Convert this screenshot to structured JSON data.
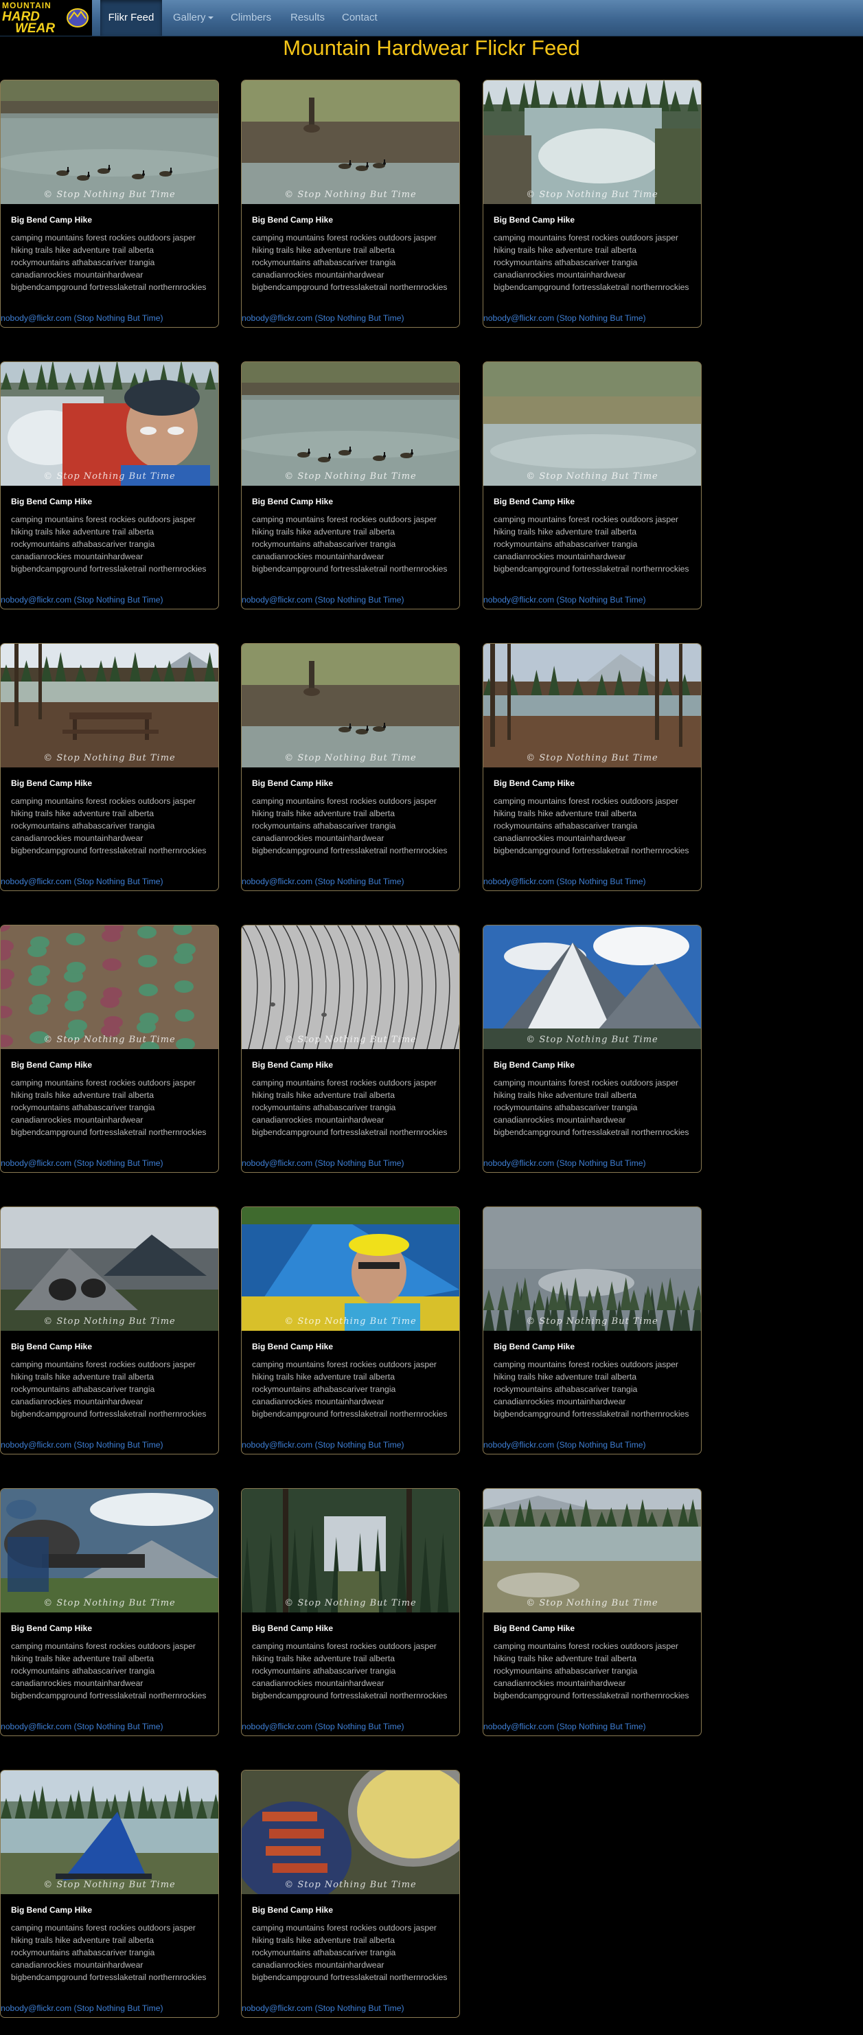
{
  "brand": {
    "line1": "MOUNTAIN",
    "line2": "HARD",
    "line3": "WEAR"
  },
  "nav": {
    "items": [
      {
        "label": "Flikr Feed",
        "active": true
      },
      {
        "label": "Gallery",
        "dropdown": true
      },
      {
        "label": "Climbers"
      },
      {
        "label": "Results"
      },
      {
        "label": "Contact"
      }
    ]
  },
  "page": {
    "title": "Mountain Hardwear Flickr Feed"
  },
  "photos": [
    {
      "title": "Big Bend Camp Hike",
      "description": "camping mountains forest rockies outdoors jasper hiking trails hike adventure trail alberta rockymountains athabascariver trangia canadianrockies mountainhardwear bigbendcampground fortresslaketrail northernrockies",
      "author": "nobody@flickr.com (Stop Nothing But Time)",
      "watermark": "© Stop Nothing But Time",
      "scene": "geese-river"
    },
    {
      "title": "Big Bend Camp Hike",
      "description": "camping mountains forest rockies outdoors jasper hiking trails hike adventure trail alberta rockymountains athabascariver trangia canadianrockies mountainhardwear bigbendcampground fortresslaketrail northernrockies",
      "author": "nobody@flickr.com (Stop Nothing But Time)",
      "watermark": "© Stop Nothing But Time",
      "scene": "goose-bank"
    },
    {
      "title": "Big Bend Camp Hike",
      "description": "camping mountains forest rockies outdoors jasper hiking trails hike adventure trail alberta rockymountains athabascariver trangia canadianrockies mountainhardwear bigbendcampground fortresslaketrail northernrockies",
      "author": "nobody@flickr.com (Stop Nothing But Time)",
      "watermark": "© Stop Nothing But Time",
      "scene": "rapids"
    },
    {
      "title": "Big Bend Camp Hike",
      "description": "camping mountains forest rockies outdoors jasper hiking trails hike adventure trail alberta rockymountains athabascariver trangia canadianrockies mountainhardwear bigbendcampground fortresslaketrail northernrockies",
      "author": "nobody@flickr.com (Stop Nothing But Time)",
      "watermark": "© Stop Nothing But Time",
      "scene": "selfie-river"
    },
    {
      "title": "Big Bend Camp Hike",
      "description": "camping mountains forest rockies outdoors jasper hiking trails hike adventure trail alberta rockymountains athabascariver trangia canadianrockies mountainhardwear bigbendcampground fortresslaketrail northernrockies",
      "author": "nobody@flickr.com (Stop Nothing But Time)",
      "watermark": "© Stop Nothing But Time",
      "scene": "geese-river"
    },
    {
      "title": "Big Bend Camp Hike",
      "description": "camping mountains forest rockies outdoors jasper hiking trails hike adventure trail alberta rockymountains athabascariver trangia canadianrockies mountainhardwear bigbendcampground fortresslaketrail northernrockies",
      "author": "nobody@flickr.com (Stop Nothing But Time)",
      "watermark": "© Stop Nothing But Time",
      "scene": "grass-river"
    },
    {
      "title": "Big Bend Camp Hike",
      "description": "camping mountains forest rockies outdoors jasper hiking trails hike adventure trail alberta rockymountains athabascariver trangia canadianrockies mountainhardwear bigbendcampground fortresslaketrail northernrockies",
      "author": "nobody@flickr.com (Stop Nothing But Time)",
      "watermark": "© Stop Nothing But Time",
      "scene": "picnic"
    },
    {
      "title": "Big Bend Camp Hike",
      "description": "camping mountains forest rockies outdoors jasper hiking trails hike adventure trail alberta rockymountains athabascariver trangia canadianrockies mountainhardwear bigbendcampground fortresslaketrail northernrockies",
      "author": "nobody@flickr.com (Stop Nothing But Time)",
      "watermark": "© Stop Nothing But Time",
      "scene": "goose-bank"
    },
    {
      "title": "Big Bend Camp Hike",
      "description": "camping mountains forest rockies outdoors jasper hiking trails hike adventure trail alberta rockymountains athabascariver trangia canadianrockies mountainhardwear bigbendcampground fortresslaketrail northernrockies",
      "author": "nobody@flickr.com (Stop Nothing But Time)",
      "watermark": "© Stop Nothing But Time",
      "scene": "campsite"
    },
    {
      "title": "Big Bend Camp Hike",
      "description": "camping mountains forest rockies outdoors jasper hiking trails hike adventure trail alberta rockymountains athabascariver trangia canadianrockies mountainhardwear bigbendcampground fortresslaketrail northernrockies",
      "author": "nobody@flickr.com (Stop Nothing But Time)",
      "watermark": "© Stop Nothing But Time",
      "scene": "leaves"
    },
    {
      "title": "Big Bend Camp Hike",
      "description": "camping mountains forest rockies outdoors jasper hiking trails hike adventure trail alberta rockymountains athabascariver trangia canadianrockies mountainhardwear bigbendcampground fortresslaketrail northernrockies",
      "author": "nobody@flickr.com (Stop Nothing But Time)",
      "watermark": "© Stop Nothing But Time",
      "scene": "sand"
    },
    {
      "title": "Big Bend Camp Hike",
      "description": "camping mountains forest rockies outdoors jasper hiking trails hike adventure trail alberta rockymountains athabascariver trangia canadianrockies mountainhardwear bigbendcampground fortresslaketrail northernrockies",
      "author": "nobody@flickr.com (Stop Nothing But Time)",
      "watermark": "© Stop Nothing But Time",
      "scene": "snowpeak"
    },
    {
      "title": "Big Bend Camp Hike",
      "description": "camping mountains forest rockies outdoors jasper hiking trails hike adventure trail alberta rockymountains athabascariver trangia canadianrockies mountainhardwear bigbendcampground fortresslaketrail northernrockies",
      "author": "nobody@flickr.com (Stop Nothing But Time)",
      "watermark": "© Stop Nothing But Time",
      "scene": "tent-grey"
    },
    {
      "title": "Big Bend Camp Hike",
      "description": "camping mountains forest rockies outdoors jasper hiking trails hike adventure trail alberta rockymountains athabascariver trangia canadianrockies mountainhardwear bigbendcampground fortresslaketrail northernrockies",
      "author": "nobody@flickr.com (Stop Nothing But Time)",
      "watermark": "© Stop Nothing But Time",
      "scene": "selfie-tent"
    },
    {
      "title": "Big Bend Camp Hike",
      "description": "camping mountains forest rockies outdoors jasper hiking trails hike adventure trail alberta rockymountains athabascariver trangia canadianrockies mountainhardwear bigbendcampground fortresslaketrail northernrockies",
      "author": "nobody@flickr.com (Stop Nothing But Time)",
      "watermark": "© Stop Nothing But Time",
      "scene": "cliff-forest"
    },
    {
      "title": "Big Bend Camp Hike",
      "description": "camping mountains forest rockies outdoors jasper hiking trails hike adventure trail alberta rockymountains athabascariver trangia canadianrockies mountainhardwear bigbendcampground fortresslaketrail northernrockies",
      "author": "nobody@flickr.com (Stop Nothing But Time)",
      "watermark": "© Stop Nothing But Time",
      "scene": "chair-person"
    },
    {
      "title": "Big Bend Camp Hike",
      "description": "camping mountains forest rockies outdoors jasper hiking trails hike adventure trail alberta rockymountains athabascariver trangia canadianrockies mountainhardwear bigbendcampground fortresslaketrail northernrockies",
      "author": "nobody@flickr.com (Stop Nothing But Time)",
      "watermark": "© Stop Nothing But Time",
      "scene": "forest-path"
    },
    {
      "title": "Big Bend Camp Hike",
      "description": "camping mountains forest rockies outdoors jasper hiking trails hike adventure trail alberta rockymountains athabascariver trangia canadianrockies mountainhardwear bigbendcampground fortresslaketrail northernrockies",
      "author": "nobody@flickr.com (Stop Nothing But Time)",
      "watermark": "© Stop Nothing But Time",
      "scene": "riverbank"
    },
    {
      "title": "Big Bend Camp Hike",
      "description": "camping mountains forest rockies outdoors jasper hiking trails hike adventure trail alberta rockymountains athabascariver trangia canadianrockies mountainhardwear bigbendcampground fortresslaketrail northernrockies",
      "author": "nobody@flickr.com (Stop Nothing But Time)",
      "watermark": "© Stop Nothing But Time",
      "scene": "blue-chair"
    },
    {
      "title": "Big Bend Camp Hike",
      "description": "camping mountains forest rockies outdoors jasper hiking trails hike adventure trail alberta rockymountains athabascariver trangia canadianrockies mountainhardwear bigbendcampground fortresslaketrail northernrockies",
      "author": "nobody@flickr.com (Stop Nothing But Time)",
      "watermark": "© Stop Nothing But Time",
      "scene": "food"
    }
  ],
  "colors": {
    "accent": "#f5c518",
    "link": "#3f7fd4",
    "card_border": "#8a7a52",
    "nav_bg": "#3d6590"
  }
}
